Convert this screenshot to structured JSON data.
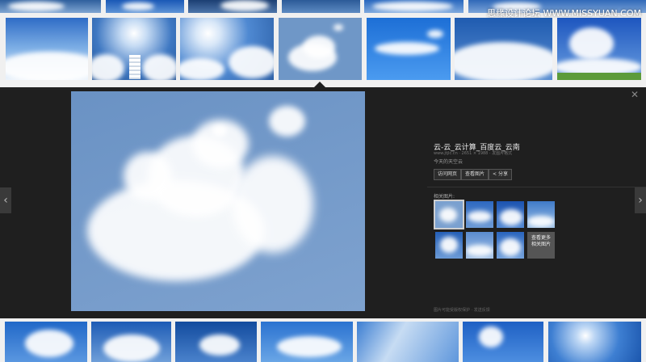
{
  "watermark": "思缘设计论坛  WWW.MISSYUAN.COM",
  "viewer": {
    "title": "云-云_云计算_百度云_云南",
    "meta": "www.jtjlc.cn · 2651 × 1988 · 发图片格式",
    "subtitle": "今天的天空云",
    "buttons": [
      "访问网页",
      "查看图片",
      "分享"
    ],
    "related_label": "相关图片:",
    "more_label": "查看更多相关图片",
    "footer": "图片可能受版权保护 · 发送反馈",
    "close_icon": "close-icon",
    "prev_icon": "chevron-left-icon",
    "next_icon": "chevron-right-icon",
    "share_icon": "share-icon"
  },
  "colors": {
    "viewer_bg": "#1f1f1f",
    "sky_blue": "#6f97c7",
    "page_bg": "#f0f0f0"
  }
}
